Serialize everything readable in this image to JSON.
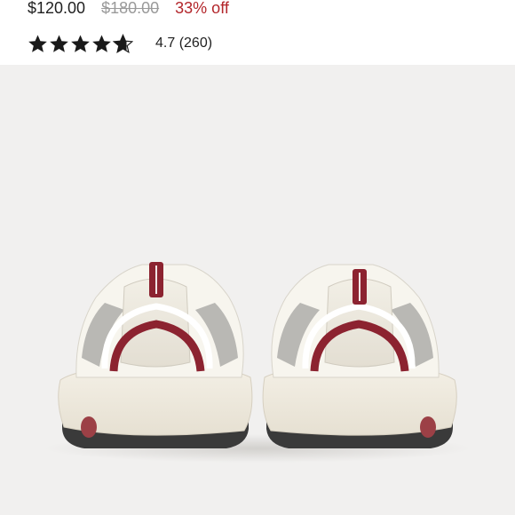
{
  "price": {
    "current": "$120.00",
    "original": "$180.00",
    "discount": "33% off"
  },
  "rating": {
    "value_text": "4.7 (260)",
    "stars_filled": 4.7,
    "stars_total": 5
  },
  "product_image": {
    "description_icon": "sneaker-pair-rear-view",
    "background_color": "#f1f0ef",
    "accent_color": "#8c2330"
  },
  "colors": {
    "text": "#1f1f1f",
    "strike": "#9a9a9a",
    "discount": "#b3262b"
  }
}
